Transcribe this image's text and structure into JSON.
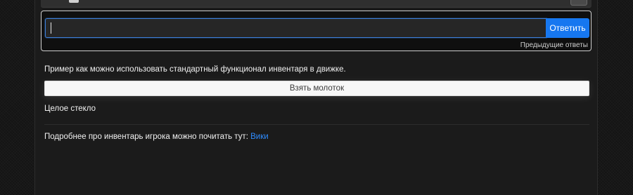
{
  "answer": {
    "input_value": "",
    "placeholder": "",
    "submit_label": "Ответить",
    "previous_answers_label": "Предыдущие ответы"
  },
  "content": {
    "description": "Пример как можно использовать стандартный функционал инвентаря в движке.",
    "action_button_label": "Взять молоток",
    "status_text": "Целое стекло",
    "footer_text": "Подробнее про инвентарь игрока можно почитать тут:",
    "footer_link_label": "Вики"
  },
  "colors": {
    "accent": "#1677f0",
    "link": "#2f8cff",
    "panel_bg": "#1b1b1b",
    "page_bg": "#141414"
  },
  "icons": {
    "top_right": "menu-toggle-icon"
  }
}
